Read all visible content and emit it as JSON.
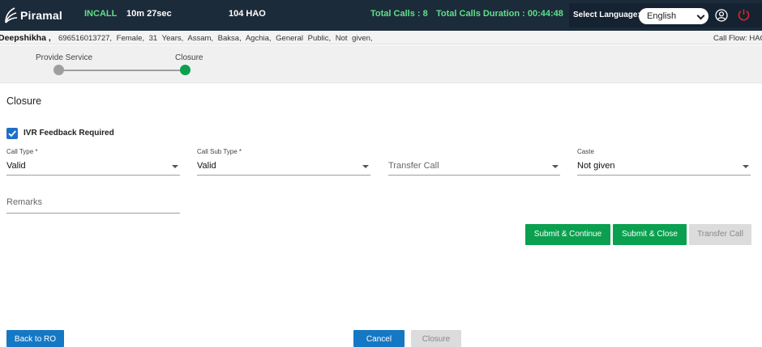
{
  "header": {
    "logo_text": "Piramal",
    "status": "INCALL",
    "timer": "10m 27sec",
    "agent_id": "104 HAO",
    "total_calls": "Total Calls : 8",
    "total_duration": "Total Calls Duration : 00:44:48",
    "language_label": "Select Language:",
    "language_value": "English"
  },
  "patient": {
    "name": "Deepshikha ,",
    "details": "696516013727,   Female,   31 Years,   Assam,   Baksa,   Agchia,   General Public,   Not given,",
    "call_flow": "Call Flow: HAO"
  },
  "stepper": {
    "steps": [
      {
        "label": "Provide Service",
        "state": "done"
      },
      {
        "label": "Closure",
        "state": "active"
      }
    ],
    "colors": {
      "done": "#9e9e9e",
      "active": "#0aa04f"
    }
  },
  "form": {
    "title": "Closure",
    "ivr_feedback_label": "IVR Feedback Required",
    "ivr_feedback_checked": true,
    "call_type": {
      "label": "Call Type *",
      "value": "Valid"
    },
    "call_sub_type": {
      "label": "Call Sub Type *",
      "value": "Valid"
    },
    "transfer_call": {
      "placeholder": "Transfer Call"
    },
    "caste": {
      "label": "Caste",
      "value": "Not given"
    },
    "remarks": {
      "placeholder": "Remarks"
    }
  },
  "actions": {
    "submit_continue": "Submit & Continue",
    "submit_close": "Submit & Close",
    "transfer_call": "Transfer Call"
  },
  "footer": {
    "back": "Back to RO",
    "cancel": "Cancel",
    "closure": "Closure"
  },
  "colors": {
    "header_bg": "#1c2b3a",
    "accent_green": "#0aa04f",
    "accent_blue": "#1578c4",
    "status_green": "#5ee08a"
  }
}
